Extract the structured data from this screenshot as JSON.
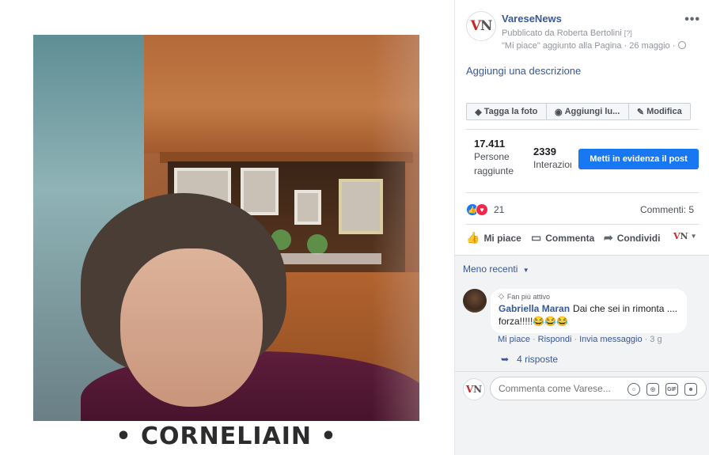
{
  "photo": {
    "caption": "• CORNELIAIN •"
  },
  "post": {
    "page_name": "VareseNews",
    "logo_letters": {
      "v": "V",
      "n": "N"
    },
    "published_by": "Pubblicato da Roberta Bertolini",
    "published_hint": "[?]",
    "added_line": "\"Mi piace\" aggiunto alla Pagina · 26 maggio ·",
    "more_icon": "more-icon",
    "add_description": "Aggiungi una descrizione"
  },
  "tag_row": {
    "tag_photo": "Tagga la foto",
    "add_location": "Aggiungi lu...",
    "edit": "Modifica"
  },
  "stats": {
    "reach_value": "17.411",
    "reach_label": "Persone raggiunte",
    "interactions_value": "2339",
    "interactions_label": "Interazioni",
    "boost_button": "Metti in evidenza il post"
  },
  "reactions": {
    "count": "21",
    "comments": "Commenti: 5"
  },
  "actions": {
    "like": "Mi piace",
    "comment": "Commenta",
    "share": "Condividi"
  },
  "comments": {
    "sort_label": "Meno recenti",
    "items": [
      {
        "badge": "Fan più attivo",
        "author": "Gabriella Maran",
        "text": "Dai che sei in rimonta .... forza!!!!!😂😂😂",
        "like_link": "Mi piace",
        "reply_link": "Rispondi",
        "message_link": "Invia messaggio",
        "time": "3 g"
      }
    ],
    "replies_label": "4 risposte",
    "input_placeholder": "Commenta come Varese..."
  },
  "colors": {
    "link_blue": "#385898",
    "primary_blue": "#1877f2",
    "love_red": "#f0284a",
    "logo_red": "#c62828"
  }
}
